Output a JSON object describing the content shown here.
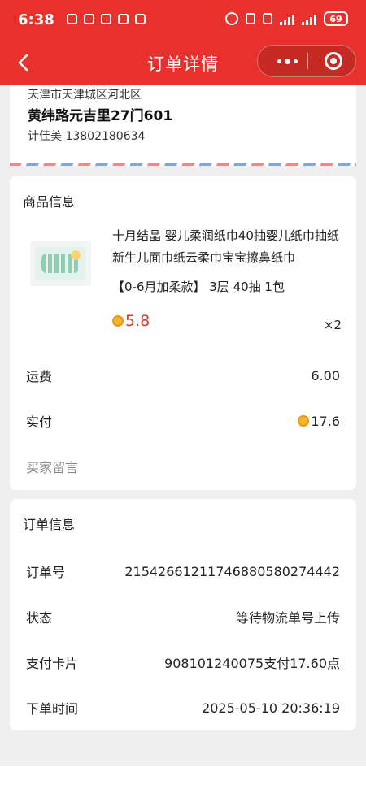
{
  "status_bar": {
    "time": "6:38",
    "battery": "69"
  },
  "nav": {
    "title": "订单详情"
  },
  "address": {
    "region": "天津市天津城区河北区",
    "detail": "黄纬路元吉里27门601",
    "contact": "计佳美 13802180634"
  },
  "goods": {
    "section_title": "商品信息",
    "product": {
      "name": "十月结晶 婴儿柔润纸巾40抽婴儿纸巾抽纸新生儿面巾纸云柔巾宝宝擦鼻纸巾",
      "spec": "【0-6月加柔款】 3层 40抽 1包",
      "price": "5.8",
      "quantity": "×2"
    },
    "shipping_label": "运费",
    "shipping_value": "6.00",
    "paid_label": "实付",
    "paid_value": "17.6",
    "message_label": "买家留言"
  },
  "order": {
    "section_title": "订单信息",
    "rows": [
      {
        "label": "订单号",
        "value": "2154266121174688058027444​2"
      },
      {
        "label": "状态",
        "value": "等待物流单号上传"
      },
      {
        "label": "支付卡片",
        "value": "908101240075支付17.60点"
      },
      {
        "label": "下单时间",
        "value": "2025-05-10 20:36:19"
      }
    ]
  },
  "icons": {
    "back": "chevron-left-icon",
    "more": "more-dots-icon",
    "close": "target-close-icon",
    "coin": "coin-icon"
  },
  "colors": {
    "brand_red": "#e8302c",
    "price_red": "#d23c2a",
    "coin_gold": "#f2b632"
  }
}
